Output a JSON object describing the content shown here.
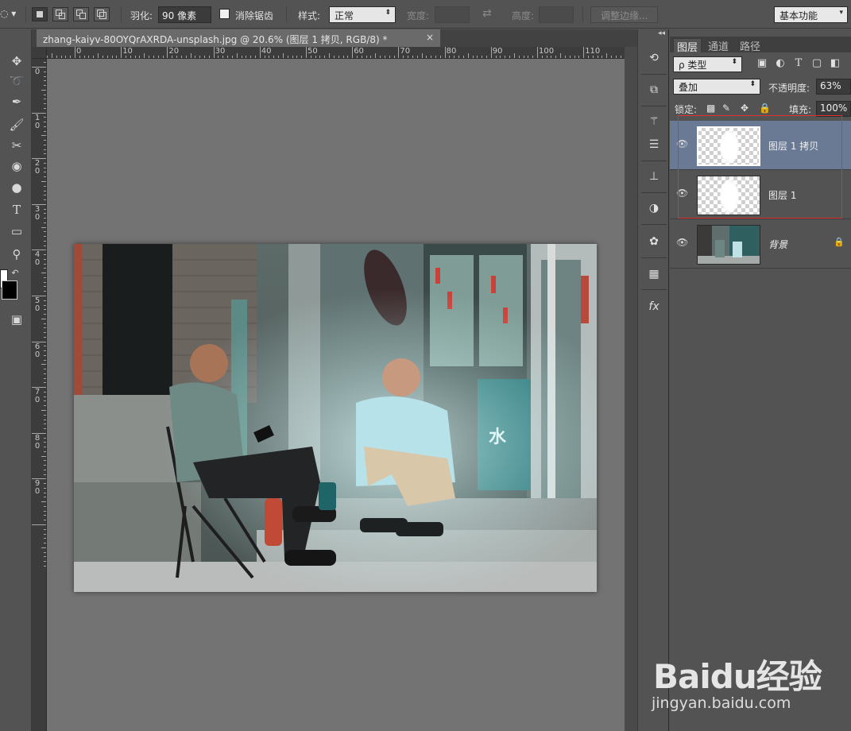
{
  "options_bar": {
    "feather_label": "羽化:",
    "feather_value": "90 像素",
    "antialias_label": "消除锯齿",
    "style_label": "样式:",
    "style_value": "正常",
    "width_label": "宽度:",
    "height_label": "高度:",
    "refine_edge_label": "调整边缘...",
    "workspace_value": "基本功能"
  },
  "document": {
    "tab_title": "zhang-kaiyv-80OYQrAXRDA-unsplash.jpg @ 20.6% (图层 1 拷贝, RGB/8) *",
    "close_glyph": "×"
  },
  "rulers": {
    "horizontal_labels": [
      "0",
      "10",
      "20",
      "30",
      "40",
      "50",
      "60",
      "70",
      "80",
      "90",
      "100",
      "110"
    ],
    "vertical_labels": [
      "0",
      "1\n0",
      "2\n0",
      "3\n0",
      "4\n0",
      "5\n0",
      "6\n0",
      "7\n0",
      "8\n0",
      "9\n0"
    ]
  },
  "layers_panel": {
    "tabs": [
      "图层",
      "通道",
      "路径"
    ],
    "filter_label": "ρ 类型",
    "blend_mode": "叠加",
    "opacity_label": "不透明度:",
    "opacity_value": "63%",
    "lock_label": "锁定:",
    "fill_label": "填充:",
    "fill_value": "100%",
    "layers": [
      {
        "name": "图层 1 拷贝",
        "selected": true
      },
      {
        "name": "图层 1",
        "selected": false
      },
      {
        "name": "背景",
        "selected": false,
        "locked": true
      }
    ]
  },
  "watermark": {
    "logo": "Baidu经验",
    "url": "jingyan.baidu.com"
  },
  "colors": {
    "ui_bg": "#535353",
    "pasteboard": "#737373",
    "selected_layer": "#6a7a95",
    "highlight_box": "#e03030"
  },
  "icons": {
    "toolbar": [
      "move-icon",
      "lasso-icon",
      "quick-select-icon",
      "eyedropper-icon",
      "brush-icon",
      "clone-stamp-icon",
      "paint-bucket-icon",
      "dodge-icon",
      "type-icon",
      "rectangle-icon",
      "zoom-icon",
      "quick-mask-icon"
    ],
    "mini_panels": [
      "history-icon",
      "properties-icon",
      "brush-presets-icon",
      "adjust-icon",
      "align-icon",
      "adjustments-icon",
      "styles-icon",
      "swatches-icon",
      "fx-icon"
    ]
  }
}
